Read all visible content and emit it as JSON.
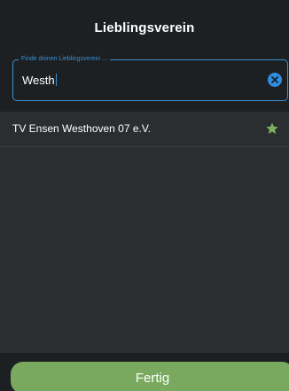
{
  "header": {
    "title": "Lieblingsverein"
  },
  "search": {
    "legend": "Finde deinen Lieblingsverein ...",
    "value": "Westh",
    "clear_icon": "clear-icon"
  },
  "results": [
    {
      "label": "TV Ensen Westhoven 07 e.V.",
      "favorite_icon": "star-icon",
      "favorite_color": "#7fae5f"
    }
  ],
  "footer": {
    "done_label": "Fertig",
    "done_color": "#79a95f"
  },
  "colors": {
    "accent": "#3a8fd0",
    "background": "#2a2e31",
    "header_background": "#1d2023"
  }
}
